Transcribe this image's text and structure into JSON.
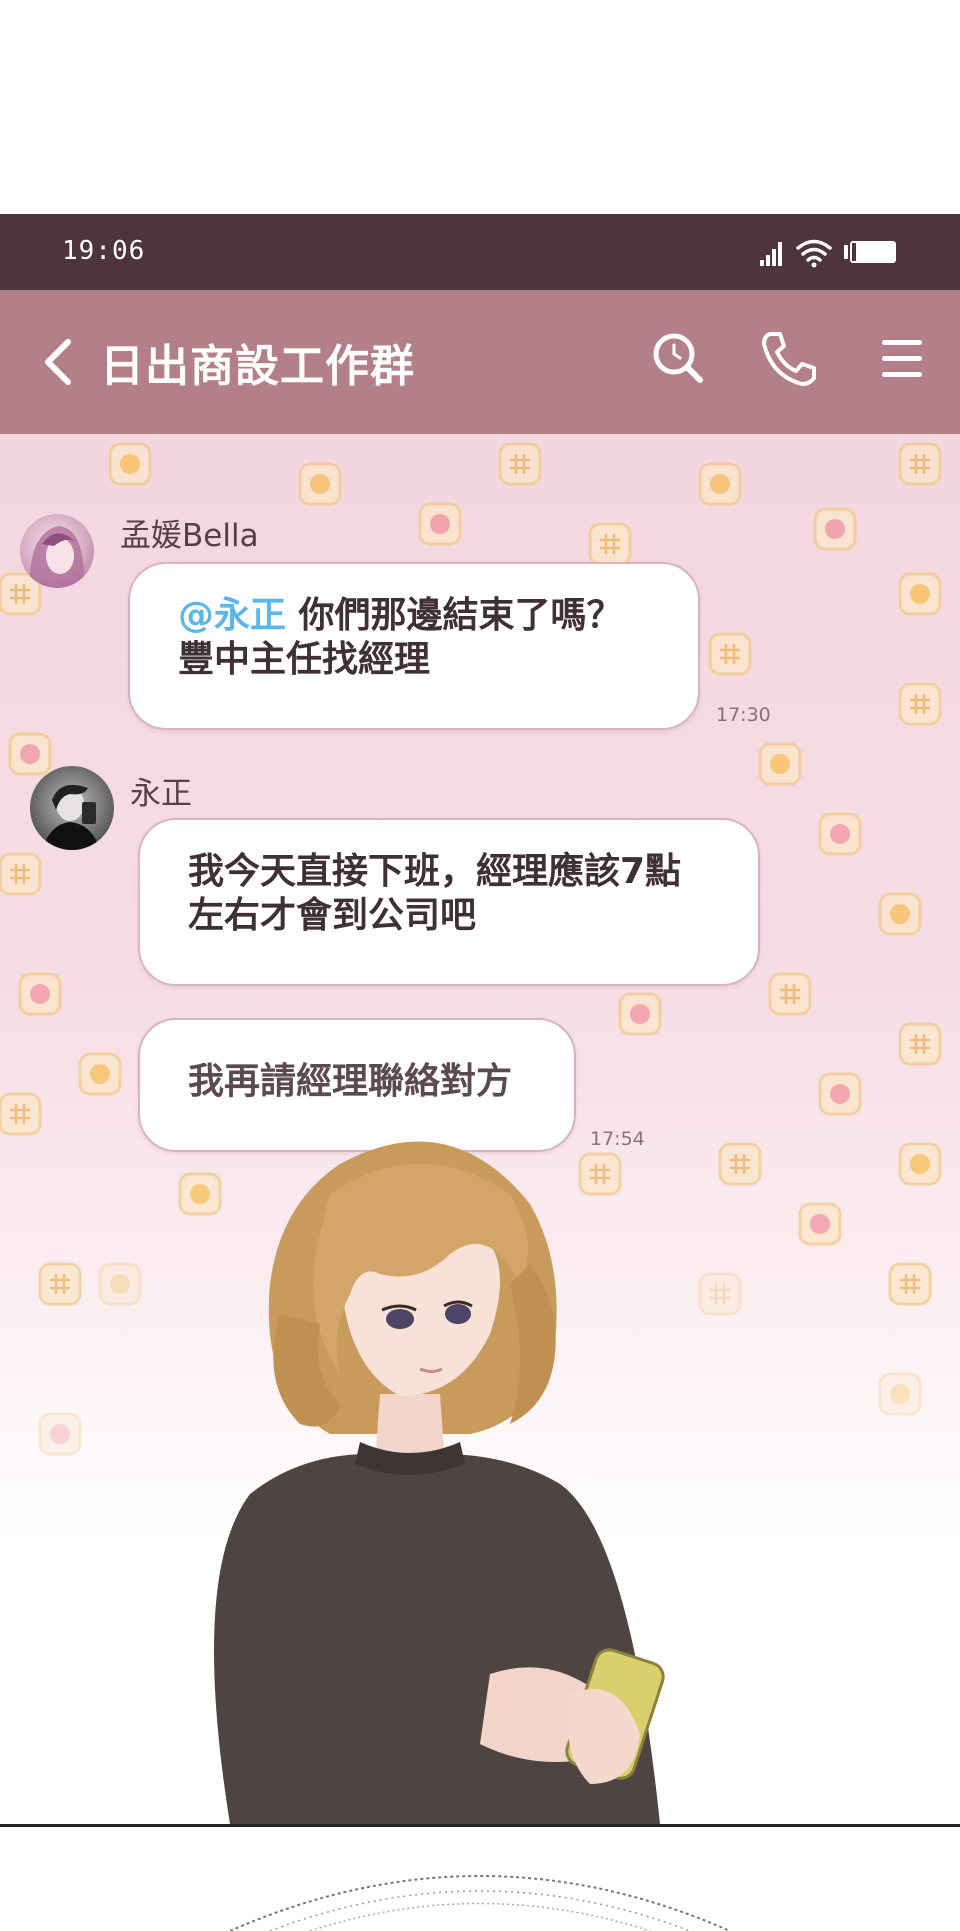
{
  "status_bar": {
    "time": "19:06",
    "icons": [
      "signal-icon",
      "wifi-icon",
      "battery-icon"
    ]
  },
  "header": {
    "title": "日出商設工作群",
    "icons": [
      "back-chevron-icon",
      "search-icon",
      "phone-icon",
      "menu-icon"
    ]
  },
  "messages": [
    {
      "sender": "孟媛Bella",
      "mention": "@永正",
      "line1": " 你們那邊結束了嗎？",
      "line2": "豐中主任找經理",
      "time": "17:30"
    },
    {
      "sender": "永正",
      "line1": "我今天直接下班，經理應該7點",
      "line2": "左右才會到公司吧"
    },
    {
      "line1": "我再請經理聯絡對方",
      "time": "17:54"
    }
  ],
  "colors": {
    "status_bar": "#4e353c",
    "header": "#b37f88",
    "mention": "#5cb6e6",
    "chat_bg": "#f3d6df"
  }
}
